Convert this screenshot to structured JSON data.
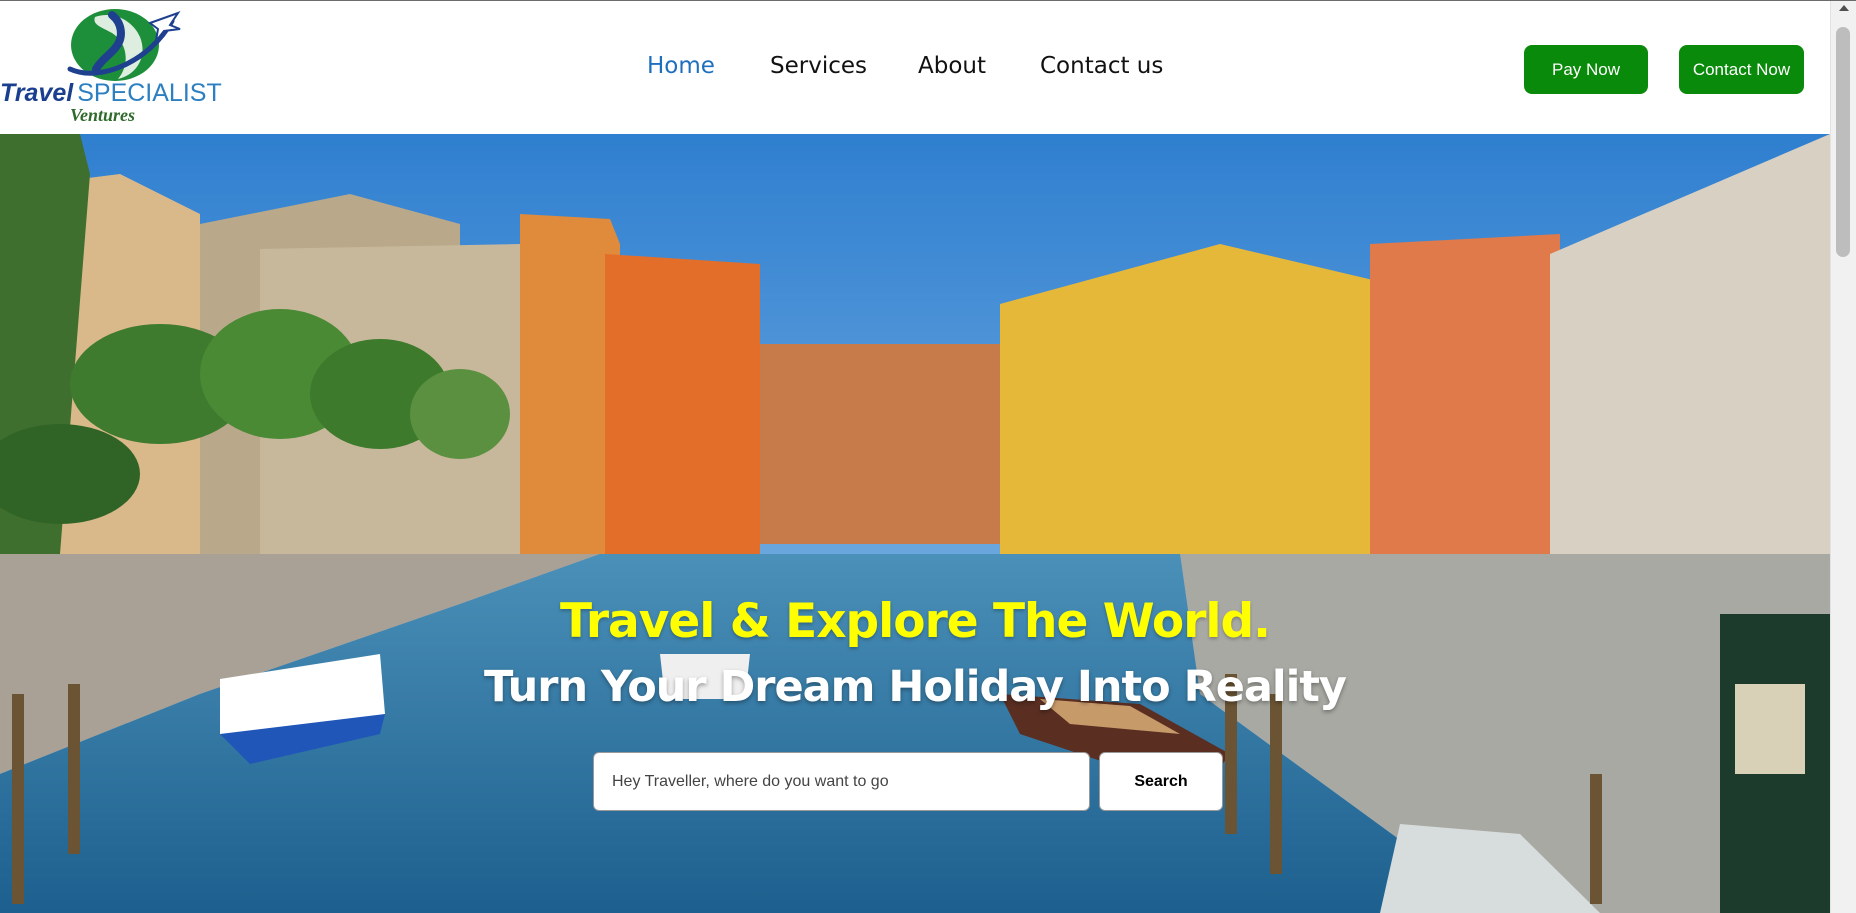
{
  "brand": {
    "logo_word1": "Travel",
    "logo_word2": "SPECIALIST",
    "logo_sub": "Ventures",
    "icon": "globe-plane-logo"
  },
  "nav": {
    "items": [
      {
        "label": "Home",
        "active": true
      },
      {
        "label": "Services",
        "active": false
      },
      {
        "label": "About",
        "active": false
      },
      {
        "label": "Contact us",
        "active": false
      }
    ]
  },
  "actions": {
    "pay_now": "Pay Now",
    "contact_now": "Contact Now"
  },
  "hero": {
    "title": "Travel & Explore The World.",
    "subtitle": "Turn Your Dream Holiday Into Reality",
    "search_placeholder": "Hey Traveller, where do you want to go",
    "search_button": "Search",
    "background": "venice-canal-photo"
  },
  "colors": {
    "accent_green": "#0a8a0a",
    "active_nav": "#1f6fbf",
    "hero_title": "#ffff00",
    "hero_subtitle": "#ffffff"
  }
}
